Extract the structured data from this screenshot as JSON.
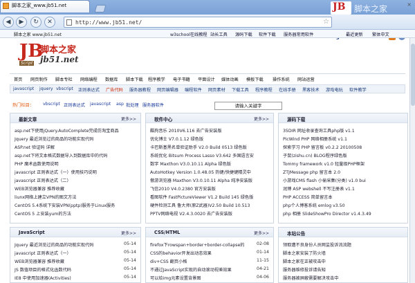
{
  "browser": {
    "tab_title": "脚本之家_www.jb51.net",
    "tab_close": "×",
    "url": "http://www.jb51.net/",
    "brand_top": "脚本之家",
    "brand_nav": "jb51.net",
    "brand_logo_letter": "JB"
  },
  "topstrip": {
    "site": "脚本之家  www.jb51.net",
    "links": [
      "w3school在线教程",
      "站长工具",
      "源码下载",
      "软件下载",
      "服务器常用软件",
      "最近更新",
      "繁体中文"
    ]
  },
  "header": {
    "logo_letters": "JB",
    "logo_script": "Script",
    "name": "脚本之家",
    "url": "jb51.net"
  },
  "mainnav": [
    "首页",
    "网页制作",
    "脚本专栏",
    "网络编程",
    "数据库",
    "脚本下载",
    "程序教学",
    "电子书籍",
    "平面设计",
    "媒体动画",
    "模板下载",
    "操作系统",
    "网站运营"
  ],
  "subnav": [
    "javascript",
    "jquery",
    "vbscript",
    "正则表达式",
    "广告代码",
    "服务器教程",
    "网页编辑器",
    "编程软件",
    "网页素材",
    "下载工具",
    "程序教程",
    "在线手册",
    "黑客技术",
    "游戏电玩",
    "软件教学"
  ],
  "hot": {
    "label": "热门栏目：",
    "items": [
      "vbscript",
      "正则表达式",
      "javascript",
      "asp",
      "批处理",
      "服务器软件"
    ],
    "search_button": "请输入关键字"
  },
  "panels": {
    "latest": {
      "title": "最新文章",
      "more": "更多>>",
      "items": [
        "asp.net下使用jQuery.AutoComplete完成仿淘宝商品",
        "Jquery 最近浏览过的商品的功能实现代码",
        "ASP.net 验证码 详解",
        "asp.net下将文本格式数据导入到数据库中的代码",
        "PHP 魔术函数使用说明",
        "javascript 正则表达式（一）使用技巧说明",
        "javascript 正则表达式（二）",
        "WEB浏览器兼容 推荐收藏",
        "liunx网络上建立VPN的图文方法",
        "CentOS 5.4系统下安装VPN(pptp)服务于Linux服务",
        "CentOS 5 上安装yum的方法"
      ]
    },
    "softcenter": {
      "title": "软件中心",
      "more": "更多>>",
      "items": [
        "酷狗音乐 2010V6.116 去广告安装版",
        "优化博士 V7.0.1.12 绿色版",
        "卡巴斯基黑名单验证助手 V2.0 Build 0513 绿色版",
        "系统优化 Bitsum Process Lasso V3.642 多国语言安",
        "数字 Maxthon V3.0.10.11 Alpha 绿色版",
        "AutoHotkey Version 1.0.48.05 热键/快捷键精灵中",
        "傲游浏览器 Maxthon V3.0.10.11 Alpha 纯净安装版",
        "飞信2010 V4.0.2380 官方安装版",
        "看图软件 FastPictureViewer V1.2 Build 145 绿色版",
        "硬件检测工具 鲁大师(原Z武器)V2.50 Build 10.513",
        "PPTV网络电视 V2.4.3.0020 去广告安装版"
      ]
    },
    "source": {
      "title": "源码下载",
      "more": "",
      "items": [
        "35DIR 网址收录查询工具php版 v1.1",
        "PicWind PHP 网络相册系统 v1.1",
        "探索学习 PHP 留言板 v0.2.2 20100508",
        "子鼠(zishu.cn) BLOG程序绿色版",
        "Tommy framework v1.0 轻量级PHP框架",
        "ZTJMessage php 留言本 2.0",
        "小游戏CMS flash 小偷采集(分类) v1.0 bui",
        "润博 ASP webshell 不写注册表 v1.1",
        "PHP ACCESS 简单留言本",
        "php个人博客系统 emlog v3.50",
        "php 相册 SlideShowPro Director v1.4.3.49"
      ]
    },
    "javascript": {
      "title": "JavaScript",
      "more": "更多>>",
      "items": [
        {
          "t": "Jquery 最近浏览过的商品的功能实现代码",
          "d": "05-14"
        },
        {
          "t": "javascript 正则表达式（一）",
          "d": "05-14"
        },
        {
          "t": "WEB浏览器兼容 推荐收藏",
          "d": "05-14"
        },
        {
          "t": "JS 数值项目的格式化函数代码",
          "d": "05-14"
        },
        {
          "t": "IE8 中使用加速器(Activities)",
          "d": "05-14"
        }
      ]
    },
    "css": {
      "title": "CSS/HTML",
      "more": "更多>>",
      "items": [
        {
          "t": "firefox下rowspan+border+border-collapse的",
          "d": "02-08"
        },
        {
          "t": "CSS的behavior开发出动态效果",
          "d": "01-14"
        },
        {
          "t": "div+CSS 翻页小格",
          "d": "11-15"
        },
        {
          "t": "不通过JavaScript实现的自动滚动视差效果",
          "d": "04-21"
        },
        {
          "t": "可以给img元素设置背景图",
          "d": "04-06"
        }
      ]
    },
    "notice": {
      "title": "本站公告",
      "more": "",
      "items": [
        "领取遭不良身份人员网监投诉流流题",
        "脚本之家安装了防火墙",
        "脚本之家在正被攻击中",
        "服务器维修投诉请告知",
        "服务器被屏蔽需要解决攻击中"
      ]
    }
  }
}
